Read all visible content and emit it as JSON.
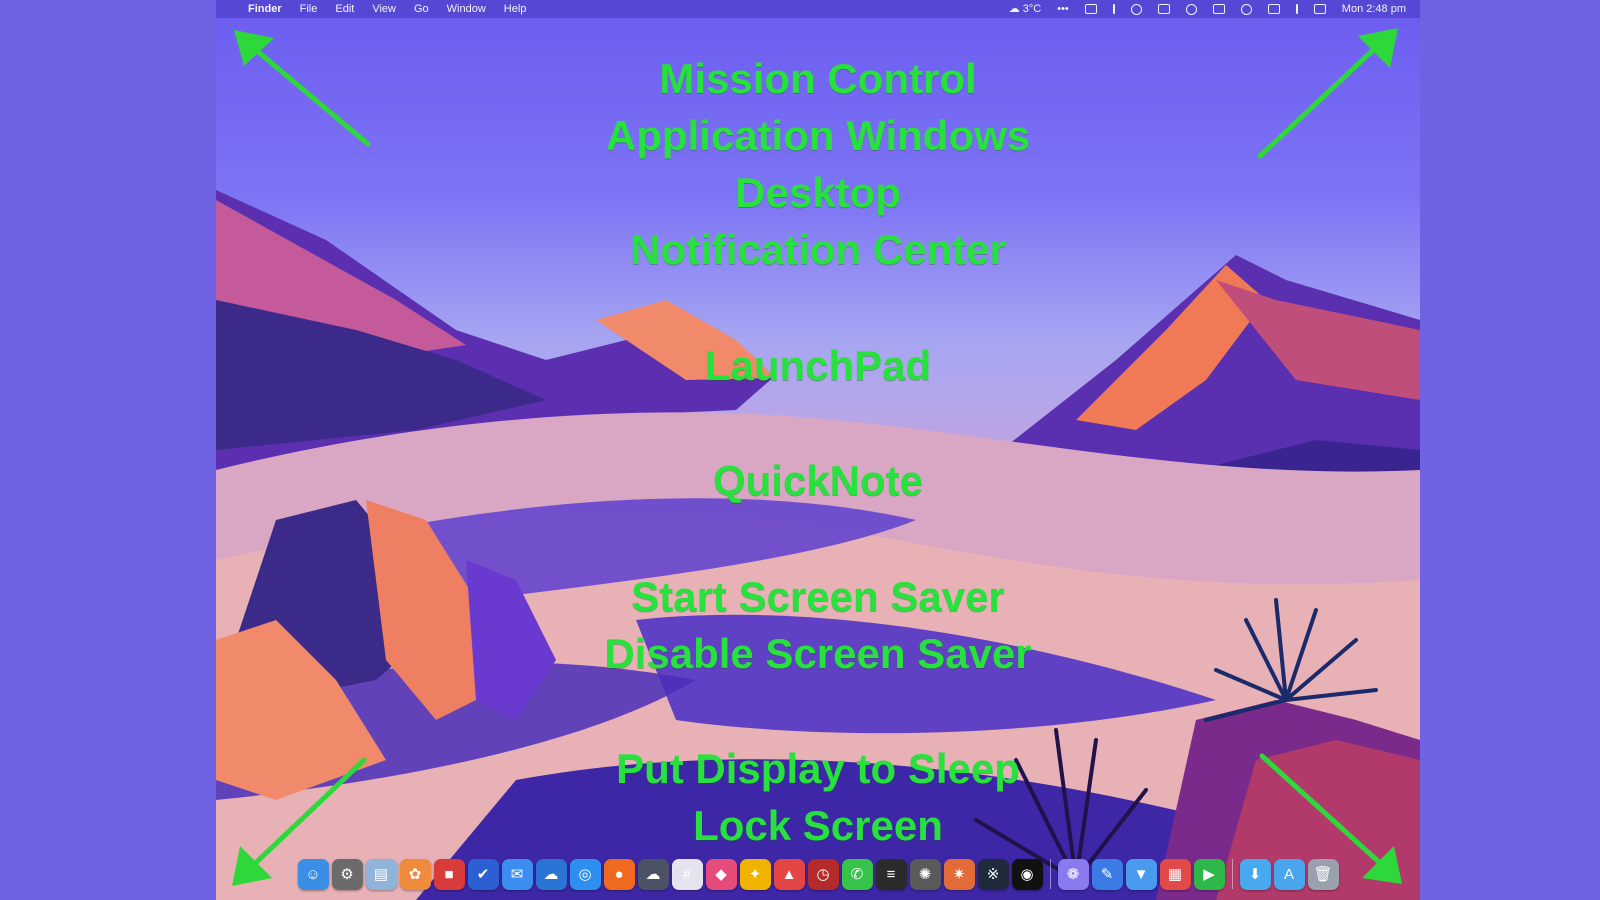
{
  "menubar": {
    "apple_glyph": "",
    "app_name": "Finder",
    "menus": [
      "File",
      "Edit",
      "View",
      "Go",
      "Window",
      "Help"
    ],
    "status": {
      "weather": "☁ 3°C",
      "ellipsis": "•••",
      "clock": "Mon 2:48 pm"
    }
  },
  "labels": {
    "top_group": [
      "Mission Control",
      "Application Windows",
      "Desktop",
      "Notification Center"
    ],
    "launchpad": "LaunchPad",
    "quicknote": "QuickNote",
    "screensaver_group": [
      "Start Screen Saver",
      "Disable Screen Saver"
    ],
    "bottom_group": [
      "Put Display to Sleep",
      "Lock Screen"
    ]
  },
  "colors": {
    "label_green": "#27e13c",
    "arrow_green": "#2fd83a",
    "background": "#6f63e3"
  },
  "dock": {
    "icons": [
      {
        "name": "finder-icon",
        "glyph": "☺",
        "color": "#3a8ee6"
      },
      {
        "name": "system-settings-icon",
        "glyph": "⚙",
        "color": "#6b6b6b"
      },
      {
        "name": "preview-icon",
        "glyph": "▤",
        "color": "#8fb3d9"
      },
      {
        "name": "photos-icon",
        "glyph": "✿",
        "color": "#f08a3c"
      },
      {
        "name": "gift-app-icon",
        "glyph": "■",
        "color": "#d93a3a"
      },
      {
        "name": "tasks-icon",
        "glyph": "✔",
        "color": "#2c5fd4"
      },
      {
        "name": "mail-icon",
        "glyph": "✉",
        "color": "#3b8ef0"
      },
      {
        "name": "onedrive-icon",
        "glyph": "☁",
        "color": "#2a74d6"
      },
      {
        "name": "safari-icon",
        "glyph": "◎",
        "color": "#2f8ff0"
      },
      {
        "name": "firefox-icon",
        "glyph": "●",
        "color": "#ef6a1f"
      },
      {
        "name": "cloud-app-icon",
        "glyph": "☁",
        "color": "#4c5266"
      },
      {
        "name": "slack-icon",
        "glyph": "#",
        "color": "#e7e3ee"
      },
      {
        "name": "airmail-icon",
        "glyph": "◆",
        "color": "#e64b7b"
      },
      {
        "name": "tes-icon",
        "glyph": "✦",
        "color": "#f0b400"
      },
      {
        "name": "bird-app-icon",
        "glyph": "▲",
        "color": "#e44646"
      },
      {
        "name": "clock-app-icon",
        "glyph": "◷",
        "color": "#b52b2b"
      },
      {
        "name": "messages-icon",
        "glyph": "✆",
        "color": "#37c24a"
      },
      {
        "name": "terminal-icon",
        "glyph": "≡",
        "color": "#2b2b2b"
      },
      {
        "name": "chatgpt-icon",
        "glyph": "✺",
        "color": "#5a5a5a"
      },
      {
        "name": "claude-icon",
        "glyph": "✷",
        "color": "#e36b3a"
      },
      {
        "name": "butterfly-app-icon",
        "glyph": "※",
        "color": "#1f2a3a"
      },
      {
        "name": "perplexity-icon",
        "glyph": "◉",
        "color": "#111111"
      },
      {
        "name": "chat-app-icon",
        "glyph": "❁",
        "color": "#8a7af0"
      },
      {
        "name": "xcode-icon",
        "glyph": "✎",
        "color": "#3a7be6"
      },
      {
        "name": "download-app-icon",
        "glyph": "▼",
        "color": "#4a9aef"
      },
      {
        "name": "calendar-grid-icon",
        "glyph": "▦",
        "color": "#e24a4a"
      },
      {
        "name": "facetime-icon",
        "glyph": "▶",
        "color": "#2fb84a"
      },
      {
        "name": "downloads-folder-icon",
        "glyph": "⬇",
        "color": "#48a9f0"
      },
      {
        "name": "applications-folder-icon",
        "glyph": "A",
        "color": "#4aa5ef"
      },
      {
        "name": "trash-icon",
        "glyph": "🗑",
        "color": "#9aa0ad"
      }
    ]
  }
}
